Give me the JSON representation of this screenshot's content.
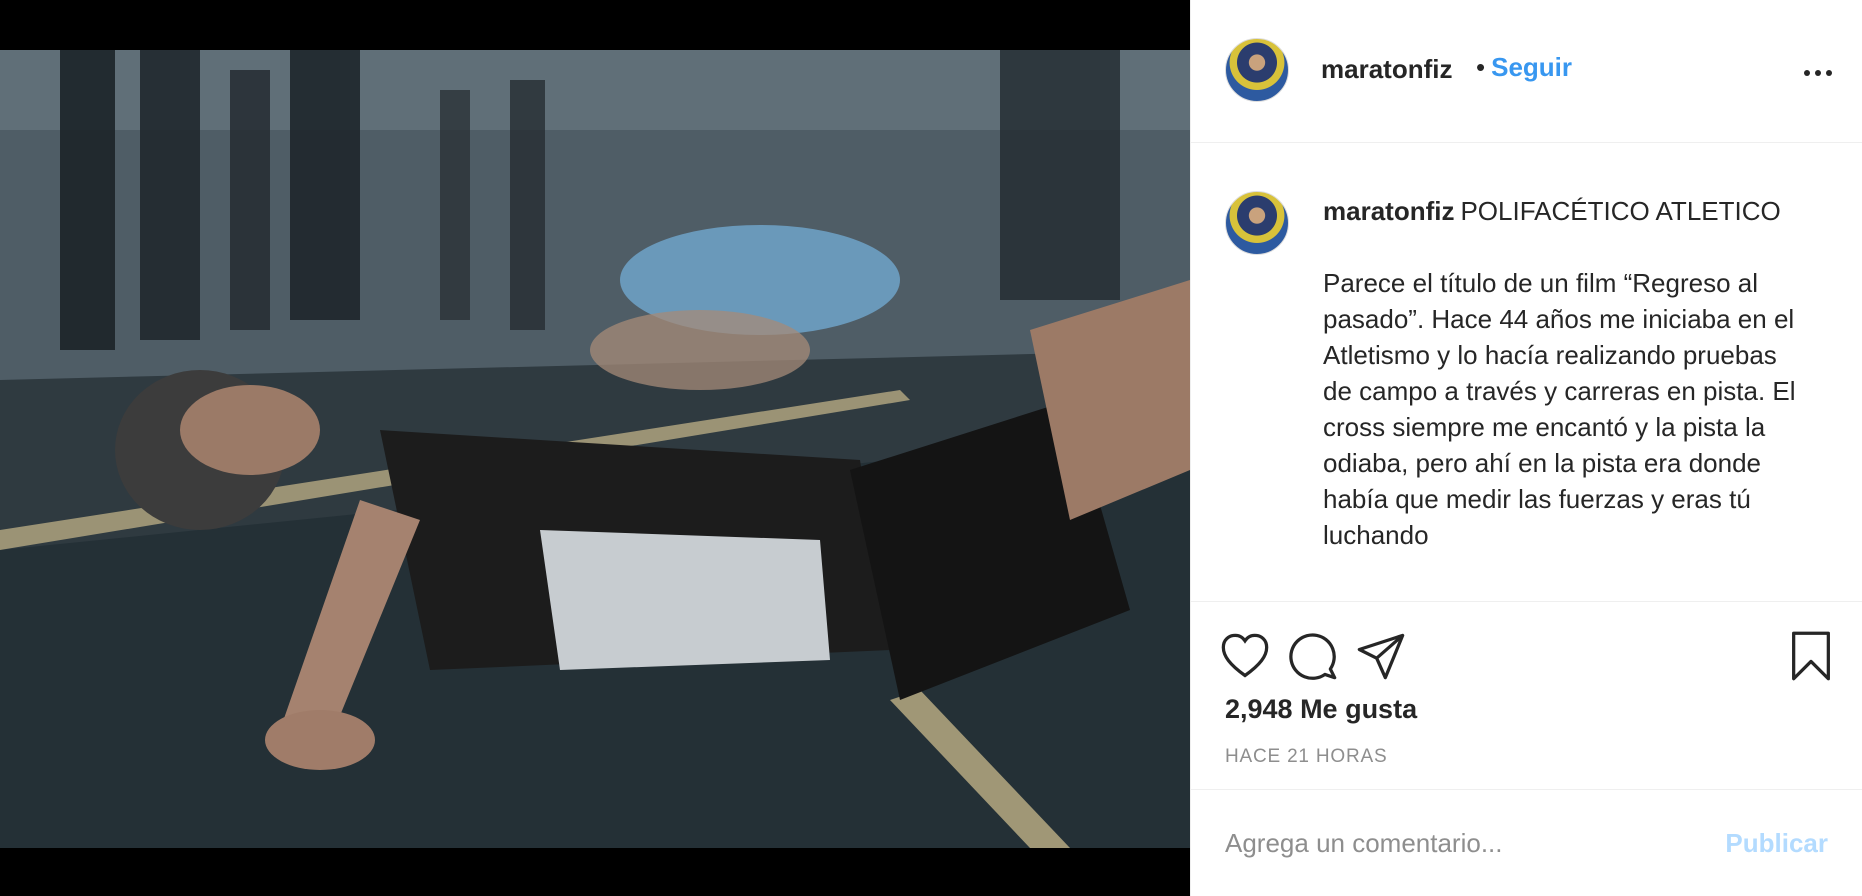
{
  "post": {
    "username": "maratonfiz",
    "follow_label": "Seguir",
    "separator": "•",
    "caption_title": "POLIFACÉTICO ATLETICO",
    "caption_body": "Parece el título de un film “Regreso al pasado”. Hace 44 años me iniciaba en el Atletismo y lo hacía realizando pruebas de campo a través y carreras en pista. El cross siempre me encantó y la pista la odiaba, pero ahí en la pista era donde había que medir las fuerzas y eras tú luchando",
    "likes": "2,948 Me gusta",
    "time": "HACE 21 HORAS"
  },
  "comment": {
    "placeholder": "Agrega un comentario...",
    "publish_label": "Publicar"
  },
  "icons": {
    "more": "more-options-icon",
    "like": "heart-icon",
    "comment": "comment-icon",
    "share": "share-icon",
    "save": "bookmark-icon"
  },
  "colors": {
    "accent": "#3897f0",
    "publish_disabled": "#b3dbff",
    "muted": "#8e8e8e"
  }
}
